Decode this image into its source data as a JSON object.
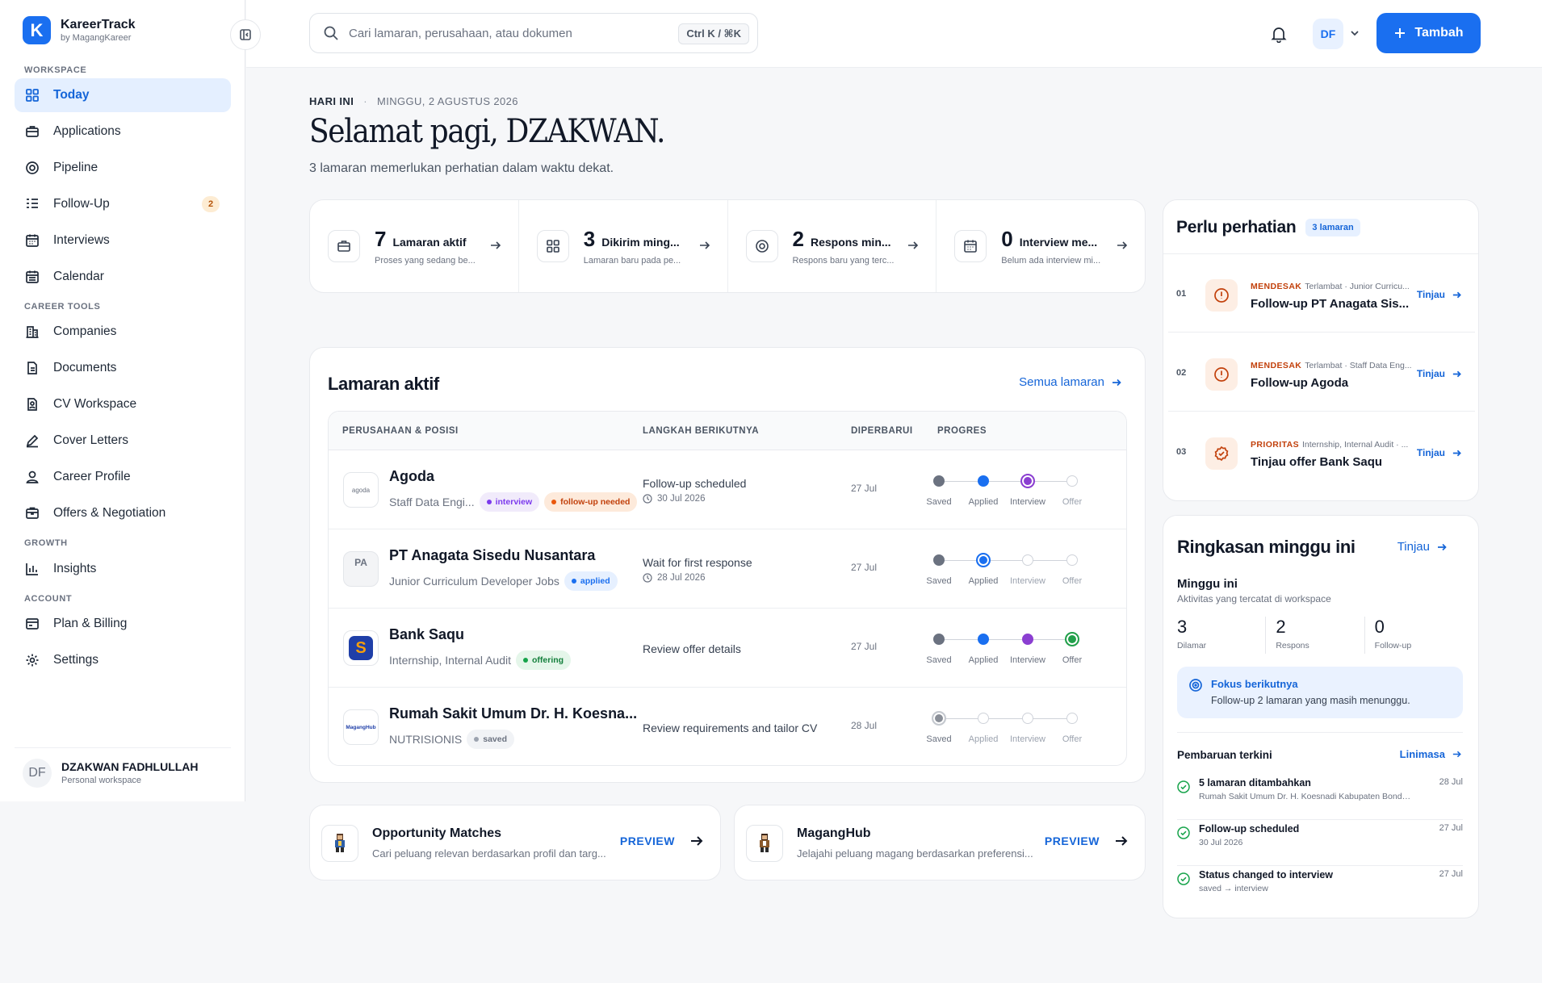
{
  "brand": {
    "name": "KareerTrack",
    "sub": "by MagangKareer",
    "logo_letter": "K",
    "color": "#1a6ff0"
  },
  "sidebar": {
    "sections": {
      "workspace": "WORKSPACE",
      "career_tools": "CAREER TOOLS",
      "growth": "GROWTH",
      "account": "ACCOUNT"
    },
    "items": [
      {
        "label": "Today",
        "icon": "grid-icon",
        "active": true
      },
      {
        "label": "Applications",
        "icon": "briefcase-icon"
      },
      {
        "label": "Pipeline",
        "icon": "target-icon"
      },
      {
        "label": "Follow-Up",
        "icon": "list-check-icon",
        "badge": "2"
      },
      {
        "label": "Interviews",
        "icon": "calendar-grid-icon"
      },
      {
        "label": "Calendar",
        "icon": "calendar-icon"
      },
      {
        "label": "Companies",
        "icon": "building-icon"
      },
      {
        "label": "Documents",
        "icon": "document-icon"
      },
      {
        "label": "CV Workspace",
        "icon": "cv-icon"
      },
      {
        "label": "Cover Letters",
        "icon": "pen-icon"
      },
      {
        "label": "Career Profile",
        "icon": "user-icon"
      },
      {
        "label": "Offers & Negotiation",
        "icon": "offer-icon"
      },
      {
        "label": "Insights",
        "icon": "bar-chart-icon"
      },
      {
        "label": "Plan & Billing",
        "icon": "billing-icon"
      },
      {
        "label": "Settings",
        "icon": "gear-icon"
      }
    ],
    "user": {
      "initials": "DF",
      "name": "DZAKWAN FADHLULLAH",
      "sub": "Personal workspace"
    }
  },
  "topbar": {
    "search_placeholder": "Cari lamaran, perusahaan, atau dokumen",
    "shortcut": "Ctrl K / ⌘K",
    "avatar": "DF",
    "add_label": "Tambah"
  },
  "greeting": {
    "today": "HARI INI",
    "date": "MINGGU, 2 AGUSTUS 2026",
    "title": "Selamat pagi, DZAKWAN.",
    "subtitle": "3 lamaran memerlukan perhatian dalam waktu dekat."
  },
  "stats": [
    {
      "num": "7",
      "label": "Lamaran aktif",
      "sub": "Proses yang sedang be..."
    },
    {
      "num": "3",
      "label": "Dikirim ming...",
      "sub": "Lamaran baru pada pe..."
    },
    {
      "num": "2",
      "label": "Respons min...",
      "sub": "Respons baru yang terc..."
    },
    {
      "num": "0",
      "label": "Interview me...",
      "sub": "Belum ada interview mi..."
    }
  ],
  "apps": {
    "title": "Lamaran aktif",
    "link": "Semua lamaran",
    "headers": [
      "PERUSAHAAN & POSISI",
      "LANGKAH BERIKUTNYA",
      "DIPERBARUI",
      "PROGRES"
    ],
    "stage_labels": [
      "Saved",
      "Applied",
      "Interview",
      "Offer"
    ],
    "rows": [
      {
        "logo": "agoda",
        "company": "Agoda",
        "position": "Staff Data Engi...",
        "tags": [
          {
            "label": "interview",
            "kind": "interview"
          },
          {
            "label": "follow-up needed",
            "kind": "follow"
          }
        ],
        "next": "Follow-up scheduled",
        "next_date": "30 Jul 2026",
        "updated": "27 Jul",
        "stage": 2,
        "offer": false
      },
      {
        "logo": "PA",
        "company": "PT Anagata Sisedu Nusantara",
        "position": "Junior Curriculum Developer Jobs",
        "tags": [
          {
            "label": "applied",
            "kind": "applied"
          }
        ],
        "next": "Wait for first response",
        "next_date": "28 Jul 2026",
        "updated": "27 Jul",
        "stage": 1,
        "offer": false
      },
      {
        "logo": "S",
        "company": "Bank Saqu",
        "position": "Internship, Internal Audit",
        "tags": [
          {
            "label": "offering",
            "kind": "offering"
          }
        ],
        "next": "Review offer details",
        "next_date": "",
        "updated": "27 Jul",
        "stage": 3,
        "offer": true
      },
      {
        "logo": "MagangHub",
        "company": "Rumah Sakit Umum Dr. H. Koesna...",
        "position": "NUTRISIONIS",
        "tags": [
          {
            "label": "saved",
            "kind": "saved"
          }
        ],
        "next": "Review requirements and tailor CV",
        "next_date": "",
        "updated": "28 Jul",
        "stage": 0,
        "offer": false
      }
    ]
  },
  "features": [
    {
      "title": "Opportunity Matches",
      "sub": "Cari peluang relevan berdasarkan profil dan targ...",
      "cta": "PREVIEW"
    },
    {
      "title": "MagangHub",
      "sub": "Jelajahi peluang magang berdasarkan preferensi...",
      "cta": "PREVIEW"
    }
  ],
  "attention": {
    "title": "Perlu perhatian",
    "count": "3 lamaran",
    "items": [
      {
        "num": "01",
        "level": "MENDESAK",
        "meta": "Terlambat · Junior Curricu...",
        "name": "Follow-up PT Anagata Sis...",
        "link": "Tinjau",
        "icon": "alert-icon"
      },
      {
        "num": "02",
        "level": "MENDESAK",
        "meta": "Terlambat · Staff Data Eng...",
        "name": "Follow-up Agoda",
        "link": "Tinjau",
        "icon": "alert-icon"
      },
      {
        "num": "03",
        "level": "PRIORITAS",
        "meta": "Internship, Internal Audit · ...",
        "name": "Tinjau offer Bank Saqu",
        "link": "Tinjau",
        "icon": "badge-check-icon"
      }
    ]
  },
  "summary": {
    "title": "Ringkasan minggu ini",
    "link": "Tinjau",
    "week_title": "Minggu ini",
    "week_sub": "Aktivitas yang tercatat di workspace",
    "mini": [
      {
        "num": "3",
        "label": "Dilamar"
      },
      {
        "num": "2",
        "label": "Respons"
      },
      {
        "num": "0",
        "label": "Follow-up"
      }
    ],
    "focus_title": "Fokus berikutnya",
    "focus_sub": "Follow-up 2 lamaran yang masih menunggu.",
    "updates_title": "Pembaruan terkini",
    "updates_link": "Linimasa",
    "updates": [
      {
        "name": "5 lamaran ditambahkan",
        "sub": "Rumah Sakit Umum Dr. H. Koesnadi Kabupaten Bondow...",
        "date": "28 Jul"
      },
      {
        "name": "Follow-up scheduled",
        "sub": "30 Jul 2026",
        "date": "27 Jul"
      },
      {
        "name": "Status changed to interview",
        "sub": "saved → interview",
        "date": "27 Jul"
      }
    ]
  },
  "colors": {
    "accent": "#1a6ff0",
    "saved": "#6b7280",
    "applied": "#1a6ff0",
    "interview": "#8b3fd1",
    "offer": "#22a04b",
    "urgent": "#c2410c"
  }
}
